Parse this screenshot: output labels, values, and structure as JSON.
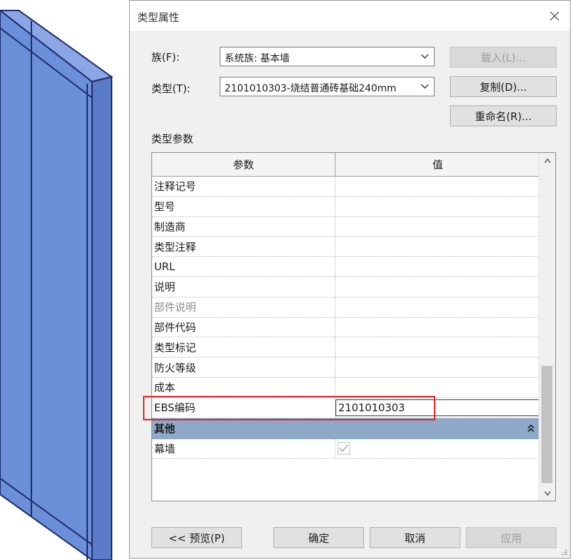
{
  "dialog": {
    "title": "类型属性"
  },
  "family": {
    "label": "族(F):",
    "value": "系统族: 基本墙"
  },
  "type": {
    "label": "类型(T):",
    "value": "2101010303-烧结普通砖基础240mm"
  },
  "buttons": {
    "load": "载入(L)...",
    "duplicate": "复制(D)...",
    "rename": "重命名(R)...",
    "preview": "<< 预览(P)",
    "ok": "确定",
    "cancel": "取消",
    "apply": "应用"
  },
  "section_title": "类型参数",
  "table": {
    "headers": [
      "参数",
      "值"
    ],
    "rows": [
      {
        "param": "注释记号",
        "value": ""
      },
      {
        "param": "型号",
        "value": ""
      },
      {
        "param": "制造商",
        "value": ""
      },
      {
        "param": "类型注释",
        "value": ""
      },
      {
        "param": "URL",
        "value": ""
      },
      {
        "param": "说明",
        "value": ""
      },
      {
        "param": "部件说明",
        "value": ""
      },
      {
        "param": "部件代码",
        "value": ""
      },
      {
        "param": "类型标记",
        "value": ""
      },
      {
        "param": "防火等级",
        "value": ""
      },
      {
        "param": "成本",
        "value": ""
      },
      {
        "param": "EBS编码",
        "value": "2101010303"
      }
    ],
    "group": {
      "label": "其他"
    },
    "group_rows": [
      {
        "param": "幕墙",
        "checked": true
      }
    ]
  },
  "colors": {
    "wall_fill": "#6b8fd8",
    "wall_stroke": "#1d2a6b",
    "group_header": "#8ea9c8",
    "highlight": "#e0232a"
  }
}
